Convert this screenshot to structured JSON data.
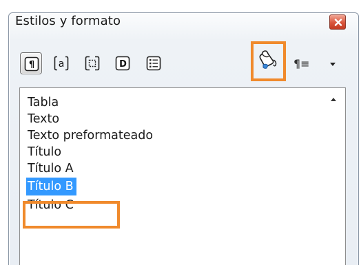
{
  "window": {
    "title": "Estilos y formato"
  },
  "toolbar": {
    "buttons": [
      {
        "name": "paragraph-styles",
        "glyph": "¶",
        "active": true
      },
      {
        "name": "character-styles",
        "glyph": "a",
        "active": false
      },
      {
        "name": "frame-styles",
        "glyph": "",
        "active": false
      },
      {
        "name": "page-styles",
        "glyph": "D",
        "active": false
      },
      {
        "name": "list-styles",
        "glyph": "",
        "active": false
      }
    ],
    "fill_format_mode": {
      "icon": "paint-bucket-icon",
      "highlighted": true
    },
    "new_style_glyph": "¶≡",
    "dropdown_icon": "chevron-down-icon"
  },
  "styles_list": {
    "items": [
      {
        "label": "Tabla",
        "selected": false
      },
      {
        "label": "Texto",
        "selected": false
      },
      {
        "label": "Texto preformateado",
        "selected": false
      },
      {
        "label": "Título",
        "selected": false
      },
      {
        "label": "Título A",
        "selected": false
      },
      {
        "label": "Título B",
        "selected": true
      },
      {
        "label": "Título C",
        "selected": false
      }
    ]
  },
  "colors": {
    "highlight_outline": "#f08a2c",
    "selection": "#3399ff",
    "close_button": "#d9553c"
  }
}
